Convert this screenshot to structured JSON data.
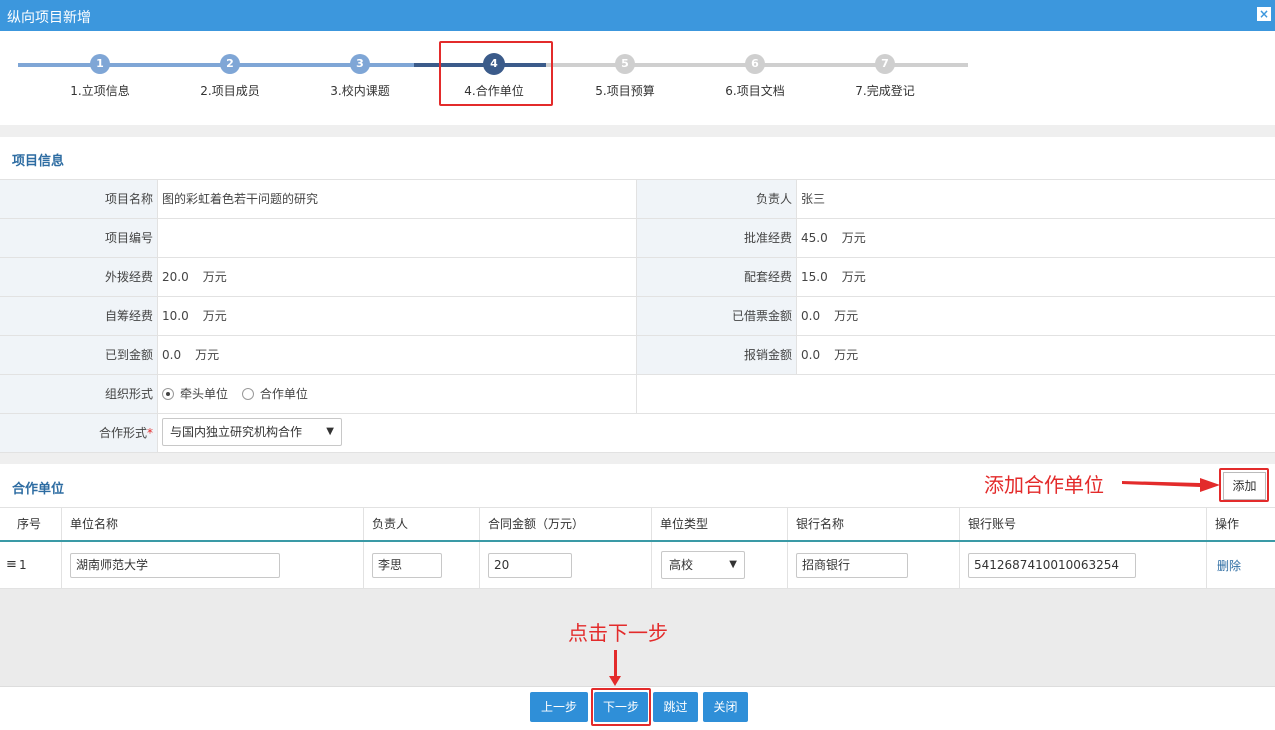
{
  "window": {
    "title": "纵向项目新增",
    "close_label": "×"
  },
  "steps": [
    {
      "num": "1",
      "label": "1.立项信息",
      "state": "done"
    },
    {
      "num": "2",
      "label": "2.项目成员",
      "state": "done"
    },
    {
      "num": "3",
      "label": "3.校内课题",
      "state": "done"
    },
    {
      "num": "4",
      "label": "4.合作单位",
      "state": "current"
    },
    {
      "num": "5",
      "label": "5.项目预算",
      "state": "todo"
    },
    {
      "num": "6",
      "label": "6.项目文档",
      "state": "todo"
    },
    {
      "num": "7",
      "label": "7.完成登记",
      "state": "todo"
    }
  ],
  "project_info": {
    "section_title": "项目信息",
    "name_label": "项目名称",
    "name_value": "图的彩虹着色若干问题的研究",
    "leader_label": "负责人",
    "leader_value": "张三",
    "code_label": "项目编号",
    "code_value": "",
    "approved_label": "批准经费",
    "approved_value": "45.0",
    "external_label": "外拨经费",
    "external_value": "20.0",
    "matching_label": "配套经费",
    "matching_value": "15.0",
    "selffund_label": "自筹经费",
    "selffund_value": "10.0",
    "borrowed_label": "已借票金额",
    "borrowed_value": "0.0",
    "received_label": "已到金额",
    "received_value": "0.0",
    "reimbursed_label": "报销金额",
    "reimbursed_value": "0.0",
    "unit": "万元",
    "org_label": "组织形式",
    "org_options": [
      "牵头单位",
      "合作单位"
    ],
    "coop_label": "合作形式",
    "required_mark": "*",
    "coop_value": "与国内独立研究机构合作"
  },
  "partners": {
    "section_title": "合作单位",
    "add_label": "添加",
    "columns": [
      "序号",
      "单位名称",
      "负责人",
      "合同金额（万元）",
      "单位类型",
      "银行名称",
      "银行账号",
      "操作"
    ],
    "rows": [
      {
        "index": "1",
        "unit_name": "湖南师范大学",
        "leader": "李思",
        "amount": "20",
        "type": "高校",
        "bank": "招商银行",
        "account": "5412687410010063254",
        "action": "删除"
      }
    ]
  },
  "annotations": {
    "add_tip": "添加合作单位",
    "next_tip": "点击下一步"
  },
  "footer": {
    "prev": "上一步",
    "next": "下一步",
    "skip": "跳过",
    "close": "关闭"
  },
  "colors": {
    "accent": "#3c97dd",
    "highlight": "#e32b2b",
    "step_done": "#7fa6d6",
    "step_current": "#3b5b8a",
    "step_todo": "#cfcfcf"
  }
}
